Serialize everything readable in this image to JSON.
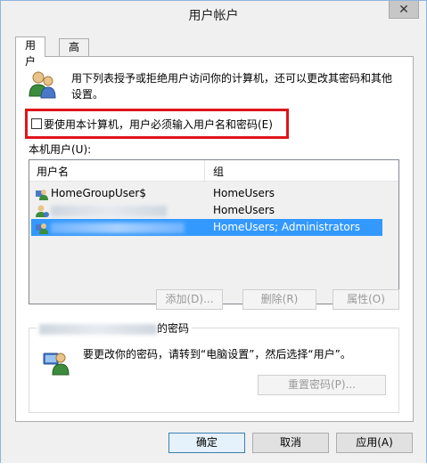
{
  "window": {
    "title": "用户帐户",
    "close_glyph": "✕"
  },
  "tabs": [
    {
      "label": "用户",
      "active": true
    },
    {
      "label": "高级",
      "active": false
    }
  ],
  "intro": {
    "icon": "users-icon",
    "text": "用下列表授予或拒绝用户访问你的计算机，还可以更改其密码和其他设置。"
  },
  "require_login": {
    "checked": false,
    "label": "要使用本计算机，用户必须输入用户名和密码(E)",
    "highlight_color": "#e0141b"
  },
  "users_section": {
    "label": "本机用户(U):",
    "columns": {
      "name": "用户名",
      "group": "组"
    },
    "rows": [
      {
        "name": "HomeGroupUser$",
        "group": "HomeUsers",
        "icon": "user-icon",
        "selected": false
      },
      {
        "name": "",
        "group": "HomeUsers",
        "icon": "user-icon",
        "selected": false
      },
      {
        "name": "",
        "group": "HomeUsers; Administrators",
        "icon": "user-icon",
        "selected": true
      }
    ],
    "selected_color": "#3399ff",
    "buttons": {
      "add": "添加(D)...",
      "delete": "删除(R)",
      "properties": "属性(O)"
    }
  },
  "password_group": {
    "title_suffix": "的密码",
    "icon": "user-key-icon",
    "text": "要更改你的密码，请转到“电脑设置”，然后选择“用户”。",
    "reset_button": "重置密码(P)..."
  },
  "footer": {
    "ok": "确定",
    "cancel": "取消",
    "apply": "应用(A)"
  }
}
